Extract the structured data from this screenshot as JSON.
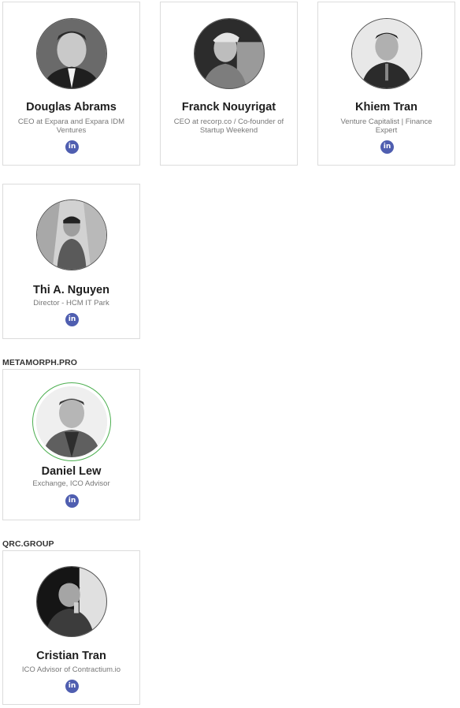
{
  "cards_top": [
    {
      "name": "Douglas Abrams",
      "role": "CEO at Expara and Expara IDM Ventures",
      "social_icon": "linkedin-icon",
      "social_text": "in"
    },
    {
      "name": "Franck Nouyrigat",
      "role": "CEO at recorp.co / Co-founder of Startup Weekend",
      "social_icon": "linkedin-icon",
      "social_text": "in"
    },
    {
      "name": "Khiem Tran",
      "role": "Venture Capitalist | Finance Expert",
      "social_icon": "linkedin-icon",
      "social_text": "in"
    },
    {
      "name": "Thi A. Nguyen",
      "role": "Director - HCM IT Park",
      "social_icon": "linkedin-icon",
      "social_text": "in"
    }
  ],
  "sections": [
    {
      "heading": "METAMORPH.PRO",
      "card": {
        "name": "Daniel Lew",
        "role": "Exchange, ICO Advisor",
        "social_icon": "linkedin-icon",
        "social_text": "in"
      }
    },
    {
      "heading": "QRC.GROUP",
      "card": {
        "name": "Cristian Tran",
        "role": "ICO Advisor of Contractium.io",
        "social_icon": "linkedin-icon",
        "social_text": "in"
      }
    }
  ],
  "colors": {
    "linkedin": "#4f5eb0",
    "highlight_ring": "#4caf50",
    "card_border": "#dcdcdc"
  }
}
